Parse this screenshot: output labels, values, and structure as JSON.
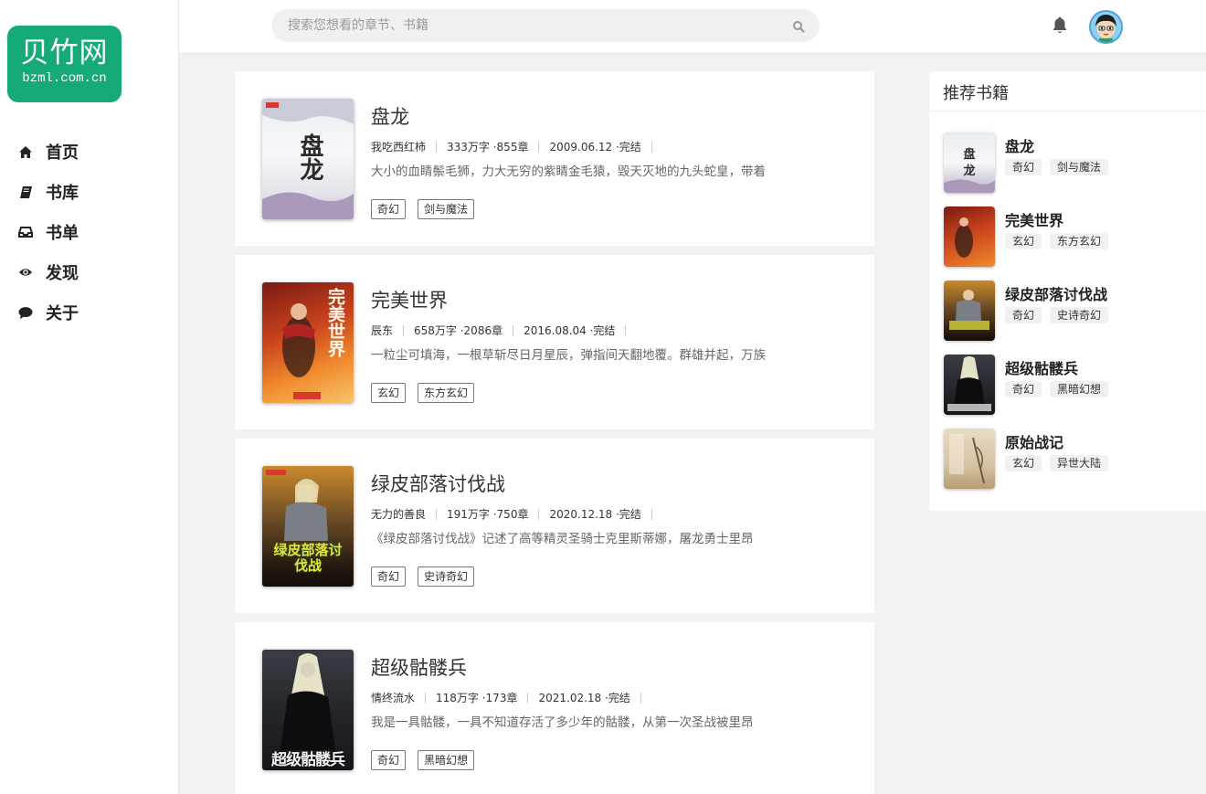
{
  "logo": {
    "title": "贝竹网",
    "subtitle": "bzml.com.cn",
    "color": "#16a97a"
  },
  "nav": [
    {
      "label": "首页",
      "icon": "home-icon"
    },
    {
      "label": "书库",
      "icon": "book-icon"
    },
    {
      "label": "书单",
      "icon": "inbox-icon"
    },
    {
      "label": "发现",
      "icon": "eye-icon"
    },
    {
      "label": "关于",
      "icon": "comment-icon"
    }
  ],
  "header": {
    "search_placeholder": "搜索您想看的章节、书籍",
    "search_icon": "search-icon",
    "bell_icon": "bell-icon",
    "avatar_icon": "avatar"
  },
  "books": [
    {
      "title": "盘龙",
      "author": "我吃西红柿",
      "stats": "333万字 ·855章",
      "date_status": "2009.06.12 ·完结",
      "desc": "大小的血睛鬃毛狮，力大无穷的紫睛金毛猿，毁天灭地的九头蛇皇，带着",
      "tags": [
        "奇幻",
        "剑与魔法"
      ],
      "cover_text": "盘龙"
    },
    {
      "title": "完美世界",
      "author": "辰东",
      "stats": "658万字 ·2086章",
      "date_status": "2016.08.04 ·完结",
      "desc": "一粒尘可填海，一根草斩尽日月星辰，弹指间天翻地覆。群雄并起，万族",
      "tags": [
        "玄幻",
        "东方玄幻"
      ],
      "cover_text": "完美世界"
    },
    {
      "title": "绿皮部落讨伐战",
      "author": "无力的善良",
      "stats": "191万字 ·750章",
      "date_status": "2020.12.18 ·完结",
      "desc": "《绿皮部落讨伐战》记述了高等精灵圣骑士克里斯蒂娜，屠龙勇士里昂",
      "tags": [
        "奇幻",
        "史诗奇幻"
      ],
      "cover_text": "绿皮部落讨伐战"
    },
    {
      "title": "超级骷髅兵",
      "author": "情终流水",
      "stats": "118万字 ·173章",
      "date_status": "2021.02.18 ·完结",
      "desc": "我是一具骷髅，一具不知道存活了多少年的骷髅，从第一次圣战被里昂",
      "tags": [
        "奇幻",
        "黑暗幻想"
      ],
      "cover_text": "超级骷髅兵"
    }
  ],
  "recommend": {
    "title": "推荐书籍",
    "items": [
      {
        "name": "盘龙",
        "tags": [
          "奇幻",
          "剑与魔法"
        ]
      },
      {
        "name": "完美世界",
        "tags": [
          "玄幻",
          "东方玄幻"
        ]
      },
      {
        "name": "绿皮部落讨伐战",
        "tags": [
          "奇幻",
          "史诗奇幻"
        ]
      },
      {
        "name": "超级骷髅兵",
        "tags": [
          "奇幻",
          "黑暗幻想"
        ]
      },
      {
        "name": "原始战记",
        "tags": [
          "玄幻",
          "异世大陆"
        ]
      }
    ]
  }
}
